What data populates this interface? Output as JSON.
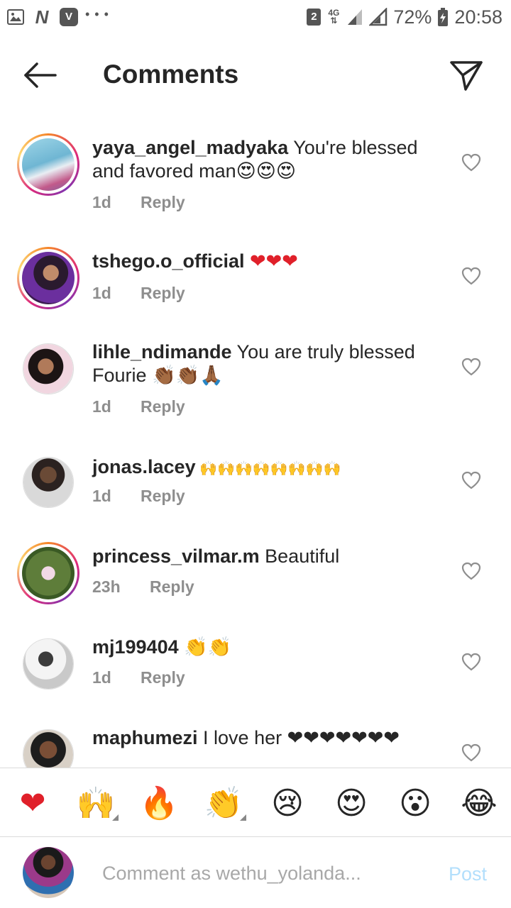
{
  "status_bar": {
    "sim_slot": "2",
    "network": "4G",
    "battery": "72%",
    "time": "20:58",
    "left_icons": [
      "gallery-icon",
      "n-app-icon",
      "v-app-icon",
      "more-dots-icon"
    ]
  },
  "header": {
    "title": "Comments"
  },
  "comments": [
    {
      "username": "yaya_angel_madyaka",
      "text": " You're blessed and favored man😍😍😍",
      "time": "1d",
      "reply": "Reply"
    },
    {
      "username": "tshego.o_official",
      "text": " ❤❤❤",
      "time": "1d",
      "reply": "Reply"
    },
    {
      "username": "lihle_ndimande",
      "text": " You are truly blessed Fourie 👏🏾👏🏾🙏🏾",
      "time": "1d",
      "reply": "Reply"
    },
    {
      "username": "jonas.lacey",
      "text": " 🙌🙌🙌🙌🙌🙌🙌🙌",
      "time": "1d",
      "reply": "Reply"
    },
    {
      "username": "princess_vilmar.m",
      "text": " Beautiful",
      "time": "23h",
      "reply": "Reply"
    },
    {
      "username": "mj199404",
      "text": " 👏👏",
      "time": "1d",
      "reply": "Reply"
    },
    {
      "username": "maphumezi",
      "text": " I love her ❤❤❤❤❤❤❤",
      "time": "",
      "reply": ""
    }
  ],
  "emoji_bar": [
    "❤",
    "🙌",
    "🔥",
    "👏",
    "😢",
    "😍",
    "😮",
    "😂"
  ],
  "composer": {
    "placeholder": "Comment as wethu_yolanda...",
    "post_label": "Post"
  },
  "colors": {
    "text": "#262626",
    "meta": "#8e8e8e",
    "post_disabled": "#b3dffc",
    "story_ring": [
      "#f58529",
      "#dd2a7b",
      "#8134af"
    ]
  }
}
